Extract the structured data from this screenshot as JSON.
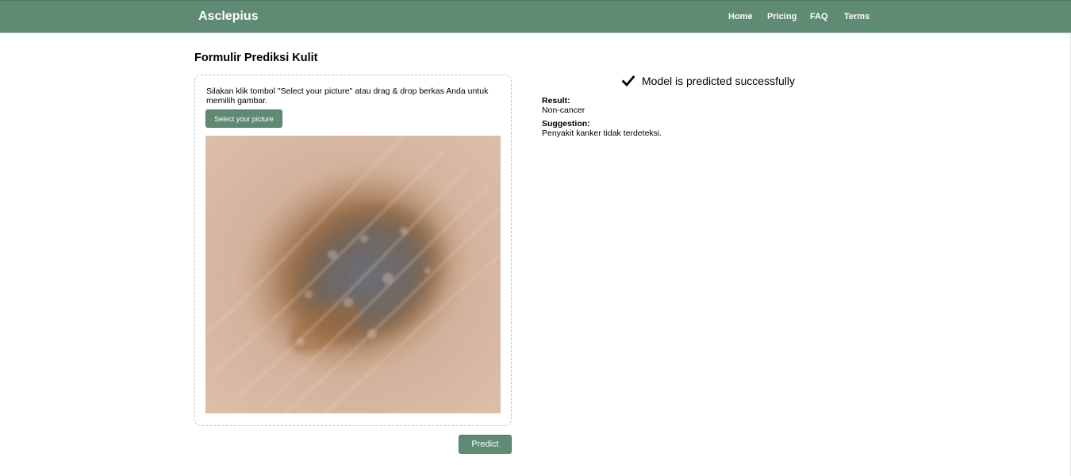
{
  "navbar": {
    "brand": "Asclepius",
    "links": [
      "Home",
      "Pricing",
      "FAQ",
      "Terms"
    ],
    "color": "#5f8a73"
  },
  "form": {
    "title": "Formulir Prediksi Kulit",
    "instructions": "Silakan klik tombol \"Select your picture\" atau drag & drop berkas Anda untuk memilih gambar.",
    "select_label": "Select your picture",
    "predict_label": "Predict"
  },
  "result": {
    "status_icon": "check-icon",
    "status_text": "Model is predicted successfully",
    "result_label": "Result:",
    "result_value": "Non-cancer",
    "suggestion_label": "Suggestion:",
    "suggestion_value": "Penyakit kanker tidak terdeteksi."
  }
}
